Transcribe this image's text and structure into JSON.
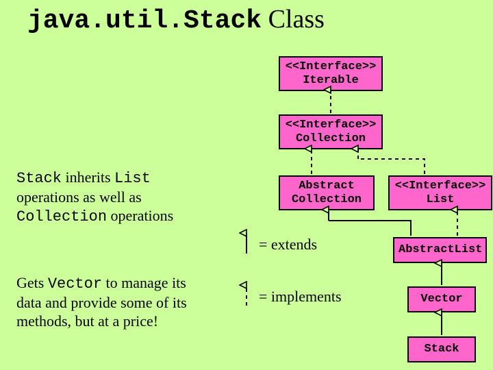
{
  "title": {
    "mono": "java.util.Stack",
    "serif": " Class"
  },
  "boxes": {
    "iterable": {
      "stereo": "<<Interface>>",
      "name": "Iterable"
    },
    "collection": {
      "stereo": "<<Interface>>",
      "name": "Collection"
    },
    "abstractcollection": {
      "line1": "Abstract",
      "line2": "Collection"
    },
    "list": {
      "stereo": "<<Interface>>",
      "name": "List"
    },
    "abstractlist": {
      "name": "AbstractList"
    },
    "vector": {
      "name": "Vector"
    },
    "stack": {
      "name": "Stack"
    }
  },
  "notes": {
    "inherits": {
      "t1a": "Stack",
      "t1b": " inherits ",
      "t1c": "List",
      "t2": "operations as well as",
      "t3a": "Collection",
      "t3b": " operations"
    },
    "vector": {
      "t1a": "Gets ",
      "t1b": "Vector",
      "t1c": " to manage its",
      "t2": "data and provide some of its",
      "t3": "methods, but at a price!"
    }
  },
  "legend": {
    "extends": "= extends",
    "implements": "= implements"
  },
  "colors": {
    "pink": "#ff66cc",
    "bg": "#ccff99"
  }
}
